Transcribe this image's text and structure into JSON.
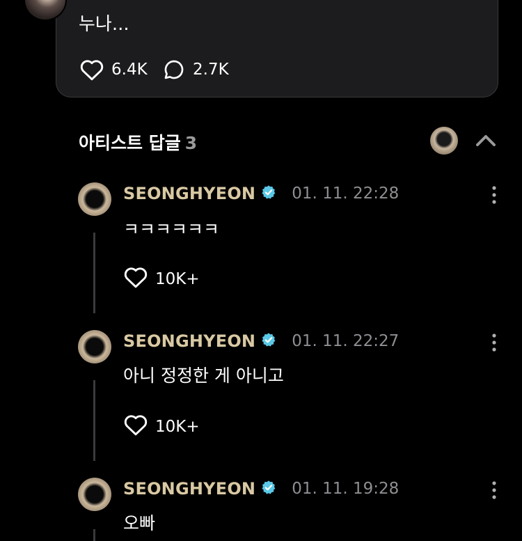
{
  "post": {
    "text": "누나...",
    "likes": "6.4K",
    "comments": "2.7K"
  },
  "section": {
    "title": "아티스트 답글",
    "count": "3"
  },
  "replies": [
    {
      "author": "SEONGHYEON",
      "time": "01. 11. 22:28",
      "text": "ㅋㅋㅋㅋㅋㅋ",
      "likes": "10K+"
    },
    {
      "author": "SEONGHYEON",
      "time": "01. 11. 22:27",
      "text": "아니 정정한 게 아니고",
      "likes": "10K+"
    },
    {
      "author": "SEONGHYEON",
      "time": "01. 11. 19:28",
      "text": "오빠",
      "likes": ""
    }
  ],
  "colors": {
    "author": "#d9c9a3",
    "verified": "#5ac8e6",
    "muted": "#8e8e93"
  }
}
